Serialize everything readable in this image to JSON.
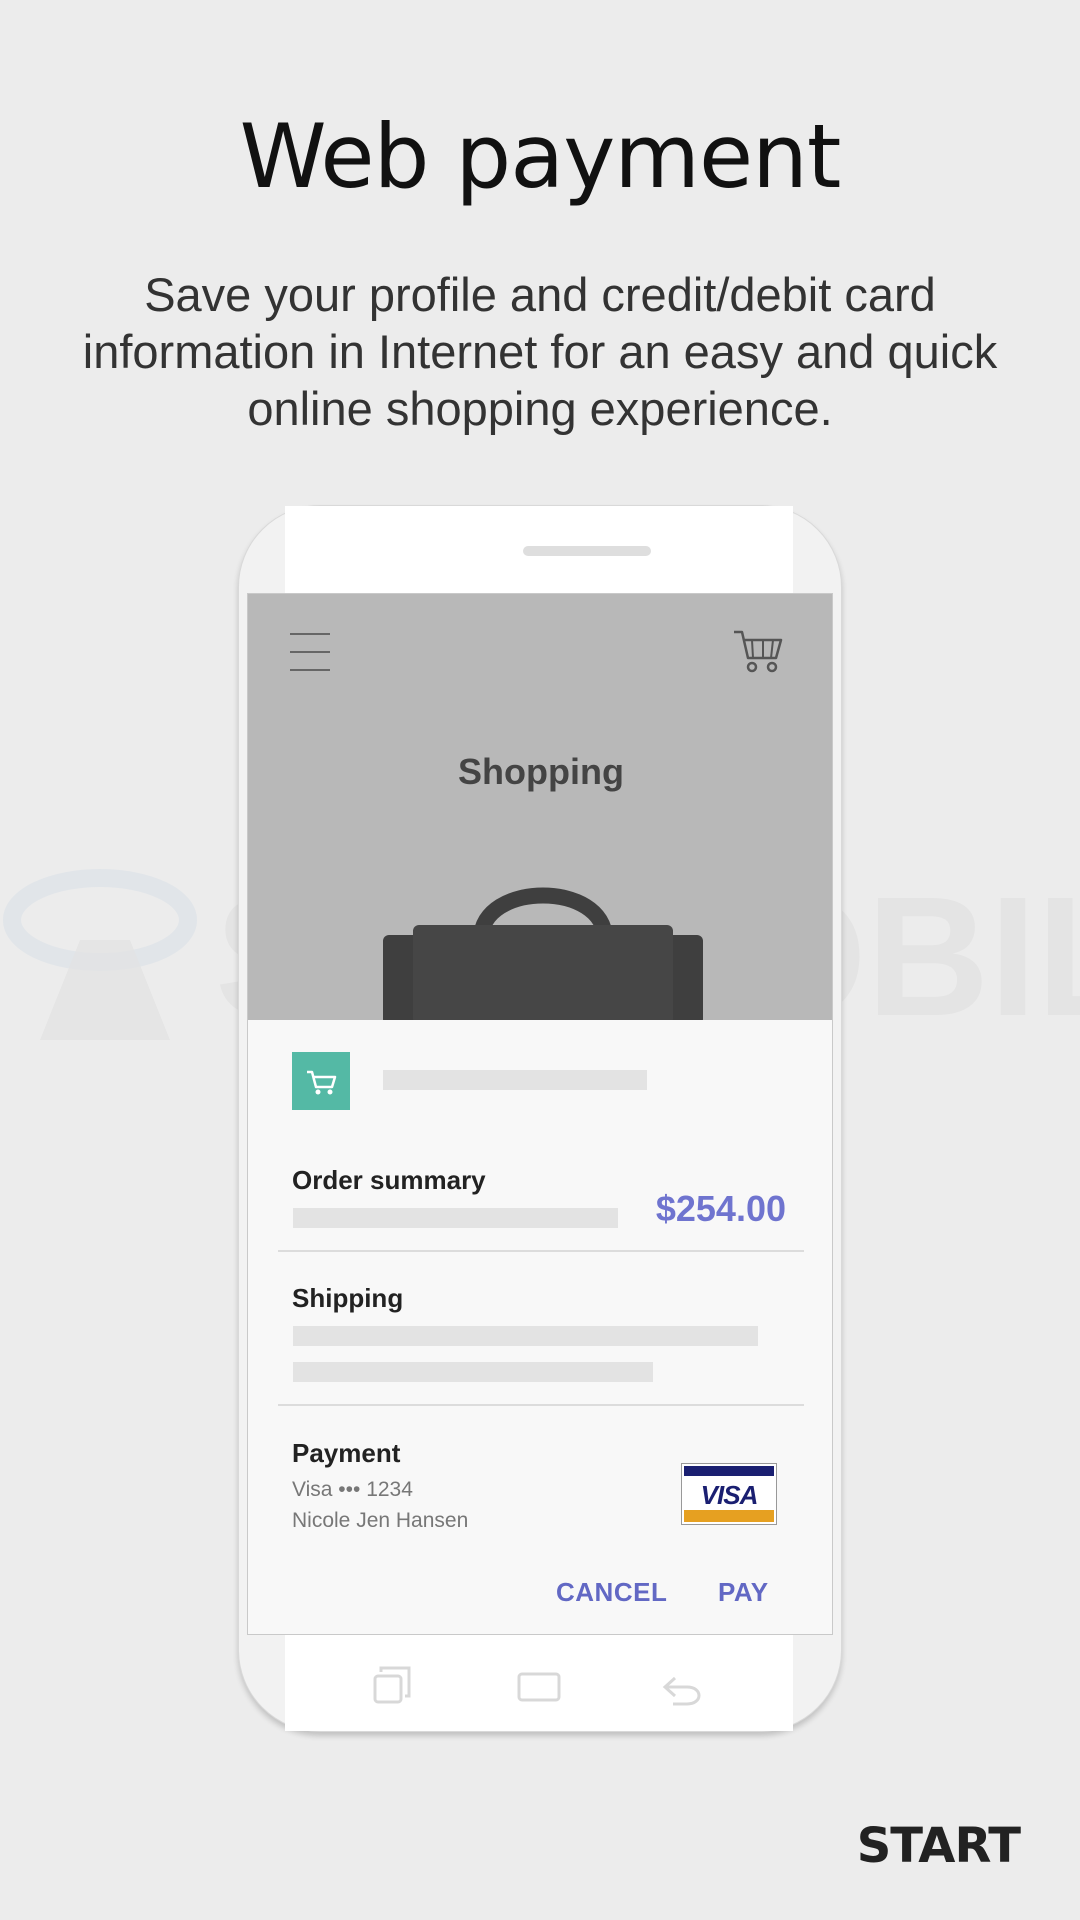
{
  "header": {
    "title": "Web payment",
    "description": "Save your profile and credit/debit card information in Internet for an easy and quick online shopping experience."
  },
  "watermark": {
    "text": "SAMMOBILE"
  },
  "illustration": {
    "app": {
      "title": "Shopping",
      "menu_icon": "hamburger-menu-icon",
      "cart_icon": "shopping-cart-icon"
    },
    "payment_sheet": {
      "merchant_icon": "shopping-cart-icon",
      "merchant_color": "#54b9a5",
      "order_summary_label": "Order summary",
      "order_total": "$254.00",
      "total_color": "#6f74cf",
      "shipping_label": "Shipping",
      "payment_label": "Payment",
      "card_number": "Visa ••• 1234",
      "card_holder": "Nicole Jen Hansen",
      "card_logo": "VISA",
      "cancel_label": "CANCEL",
      "pay_label": "PAY",
      "button_color": "#6268c4"
    },
    "nav_icons": [
      "recent-apps-icon",
      "home-icon",
      "back-icon"
    ]
  },
  "footer": {
    "start_label": "START"
  }
}
